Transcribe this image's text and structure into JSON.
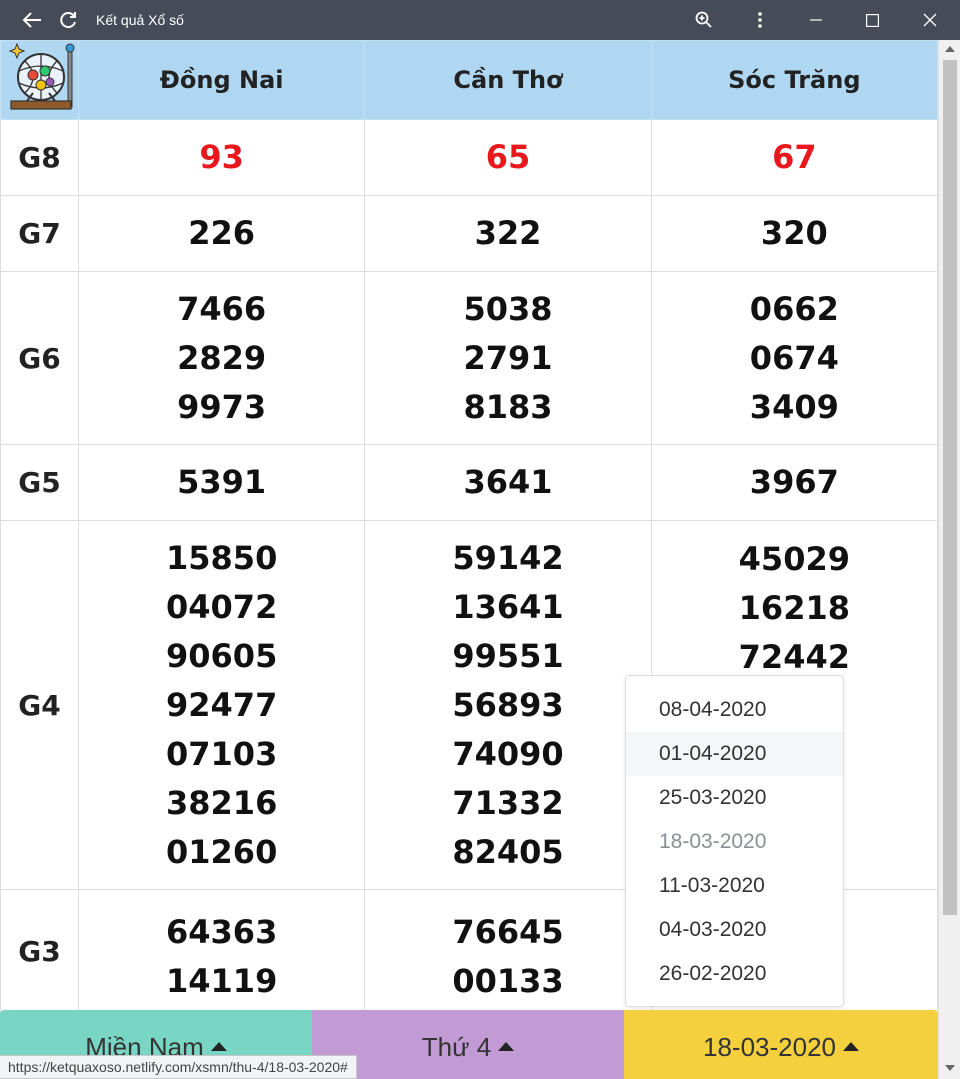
{
  "window": {
    "title": "Kết quả Xổ số"
  },
  "table": {
    "provinces": [
      "Đồng Nai",
      "Cần Thơ",
      "Sóc Trăng"
    ],
    "rows": [
      {
        "prize": "G8",
        "values": [
          [
            "93"
          ],
          [
            "65"
          ],
          [
            "67"
          ]
        ]
      },
      {
        "prize": "G7",
        "values": [
          [
            "226"
          ],
          [
            "322"
          ],
          [
            "320"
          ]
        ]
      },
      {
        "prize": "G6",
        "values": [
          [
            "7466",
            "2829",
            "9973"
          ],
          [
            "5038",
            "2791",
            "8183"
          ],
          [
            "0662",
            "0674",
            "3409"
          ]
        ]
      },
      {
        "prize": "G5",
        "values": [
          [
            "5391"
          ],
          [
            "3641"
          ],
          [
            "3967"
          ]
        ]
      },
      {
        "prize": "G4",
        "values": [
          [
            "15850",
            "04072",
            "90605",
            "92477",
            "07103",
            "38216",
            "01260"
          ],
          [
            "59142",
            "13641",
            "99551",
            "56893",
            "74090",
            "71332",
            "82405"
          ],
          [
            "45029",
            "16218",
            "72442"
          ]
        ]
      },
      {
        "prize": "G3",
        "values": [
          [
            "64363",
            "14119"
          ],
          [
            "76645",
            "00133"
          ],
          []
        ]
      }
    ]
  },
  "date_dropdown": {
    "options": [
      "08-04-2020",
      "01-04-2020",
      "25-03-2020",
      "18-03-2020",
      "11-03-2020",
      "04-03-2020",
      "26-02-2020"
    ],
    "hovered": "01-04-2020",
    "selected": "18-03-2020"
  },
  "bottom_bar": {
    "region": "Miền Nam",
    "day": "Thứ 4",
    "date": "18-03-2020"
  },
  "status_url": "https://ketquaxoso.netlify.com/xsmn/thu-4/18-03-2020#",
  "colors": {
    "special_prize": "#e8181d",
    "header_bg": "#b0d7f2",
    "region_btn": "#7ad6c4",
    "day_btn": "#c39bd4",
    "date_btn": "#f4d03f"
  }
}
